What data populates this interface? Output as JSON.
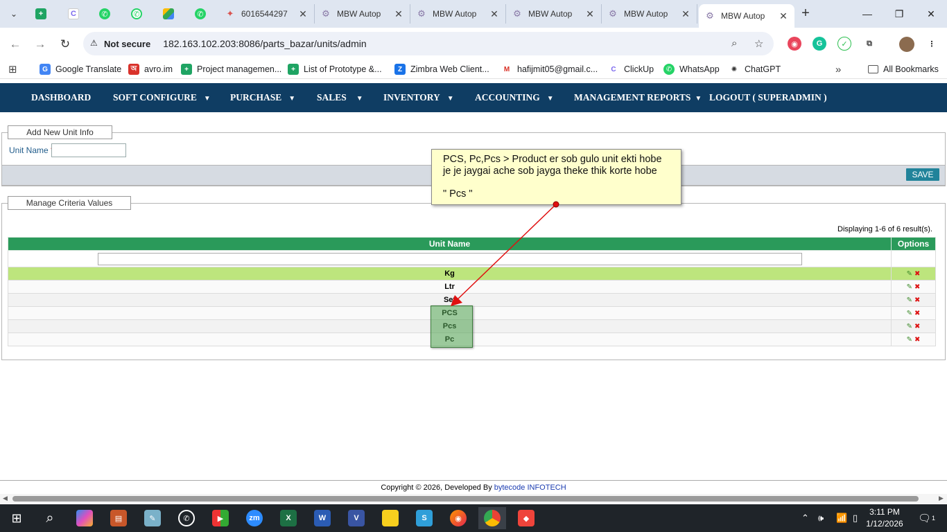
{
  "browser": {
    "tabs": [
      {
        "title": "6016544297"
      },
      {
        "title": "MBW Autop"
      },
      {
        "title": "MBW Autop"
      },
      {
        "title": "MBW Autop"
      },
      {
        "title": "MBW Autop"
      },
      {
        "title": "MBW Autop"
      }
    ],
    "address": {
      "security_label": "Not secure",
      "url": "182.163.102.203:8086/parts_bazar/units/admin"
    },
    "bookmarks": [
      {
        "label": "Google Translate"
      },
      {
        "label": "avro.im"
      },
      {
        "label": "Project managemen..."
      },
      {
        "label": "List of Prototype &..."
      },
      {
        "label": "Zimbra Web Client..."
      },
      {
        "label": "hafijmit05@gmail.c..."
      },
      {
        "label": "ClickUp"
      },
      {
        "label": "WhatsApp"
      },
      {
        "label": "ChatGPT"
      }
    ],
    "all_bookmarks": "All Bookmarks"
  },
  "nav": {
    "items": [
      {
        "label": "DASHBOARD"
      },
      {
        "label": "SOFT CONFIGURE"
      },
      {
        "label": "PURCHASE"
      },
      {
        "label": "SALES"
      },
      {
        "label": "INVENTORY"
      },
      {
        "label": "ACCOUNTING"
      },
      {
        "label": "MANAGEMENT REPORTS"
      },
      {
        "label": "LOGOUT ( SUPERADMIN )"
      }
    ]
  },
  "add_form": {
    "legend": "Add New Unit Info",
    "unit_name_label": "Unit Name",
    "required_mark": "*",
    "unit_name_value": "",
    "save_label": "SAVE"
  },
  "manage": {
    "legend": "Manage Criteria Values",
    "displaying": "Displaying 1-6 of 6 result(s).",
    "columns": {
      "unit_name": "Unit Name",
      "options": "Options"
    },
    "filter_value": "",
    "rows": [
      {
        "unit": "Kg"
      },
      {
        "unit": "Ltr"
      },
      {
        "unit": "Set"
      },
      {
        "unit": "PCS"
      },
      {
        "unit": "Pcs"
      },
      {
        "unit": "Pc"
      }
    ]
  },
  "annotation": {
    "line1": "PCS, Pc,Pcs > Product er sob gulo unit ekti hobe",
    "line2": "je je jaygai ache sob jayga theke thik korte hobe",
    "line3": "\" Pcs \""
  },
  "footer": {
    "text": "Copyright © 2026, Developed By ",
    "company": "bytecode INFOTECH"
  },
  "taskbar": {
    "time": "3:11 PM",
    "date": "1/12/2026",
    "notif_count": "1"
  },
  "colors": {
    "nav_bg": "#0f3d63",
    "grid_header": "#2a9a5a",
    "selected_row": "#bde57d",
    "save_button": "#21839a",
    "note_bg": "#ffffcc",
    "arrow": "#e01010"
  }
}
